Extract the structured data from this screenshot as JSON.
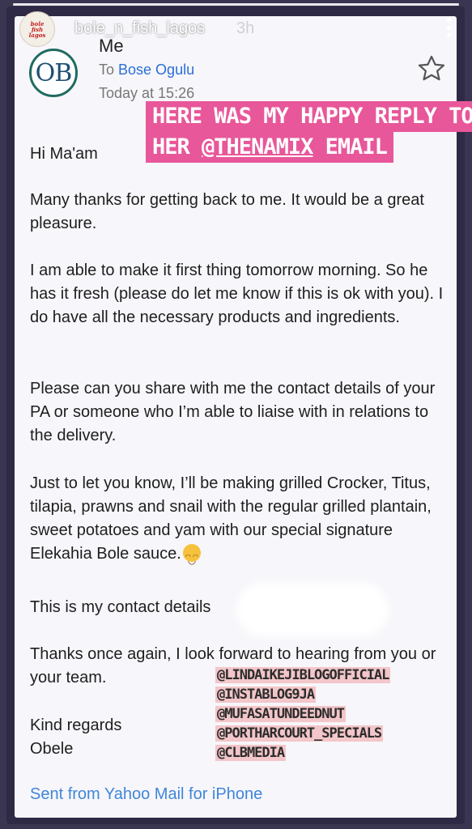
{
  "story": {
    "username": "bole_n_fish_lagos",
    "time": "3h",
    "avatar_text": "bole\nfish\nlagos"
  },
  "email": {
    "sender_initials": "OB",
    "from": "Me",
    "to_prefix": "To",
    "to_name": "Bose Ogulu",
    "date": "Today at 15:26",
    "greeting": "Hi Ma'am",
    "paragraphs": [
      "Many thanks for getting back to me. It would be a great pleasure.",
      "I am able to make it first thing tomorrow morning. So he has it fresh (please do let me know if this is ok with you).  I do have all the necessary products and ingredients.",
      "Please can you share with me the contact details of your PA or someone who I’m able to liaise with in relations to the delivery.",
      "Just to let you know, I’ll be making grilled Crocker, Titus, tilapia, prawns and snail with the regular grilled plantain, sweet potatoes and yam with our special signature Elekahia Bole sauce."
    ],
    "contact_line": "This is my contact details",
    "closing_line": "Thanks once again, I look forward to hearing from you or your team.",
    "sign_off_1": "Kind regards",
    "sign_off_2": "Obele",
    "signature": "Sent from Yahoo Mail for iPhone"
  },
  "overlay": {
    "line1": "HERE WAS MY HAPPY  REPLY TO",
    "line2_prefix": "HER ",
    "line2_mention": "@THENAMIX",
    "line2_suffix": "  EMAIL",
    "tags": [
      "@LINDAIKEJIBLOGOFFICIAL",
      "@INSTABLOG9JA",
      "@MUFASATUNDEEDNUT",
      "@PORTHARCOURT_SPECIALS",
      "@CLBMEDIA"
    ]
  },
  "colors": {
    "highlight": "#e8579a",
    "link": "#2a6fd6",
    "tag_bg": "#f3c6c9"
  },
  "icons": [
    "star-icon",
    "more-icon",
    "smile-emoji-icon"
  ]
}
